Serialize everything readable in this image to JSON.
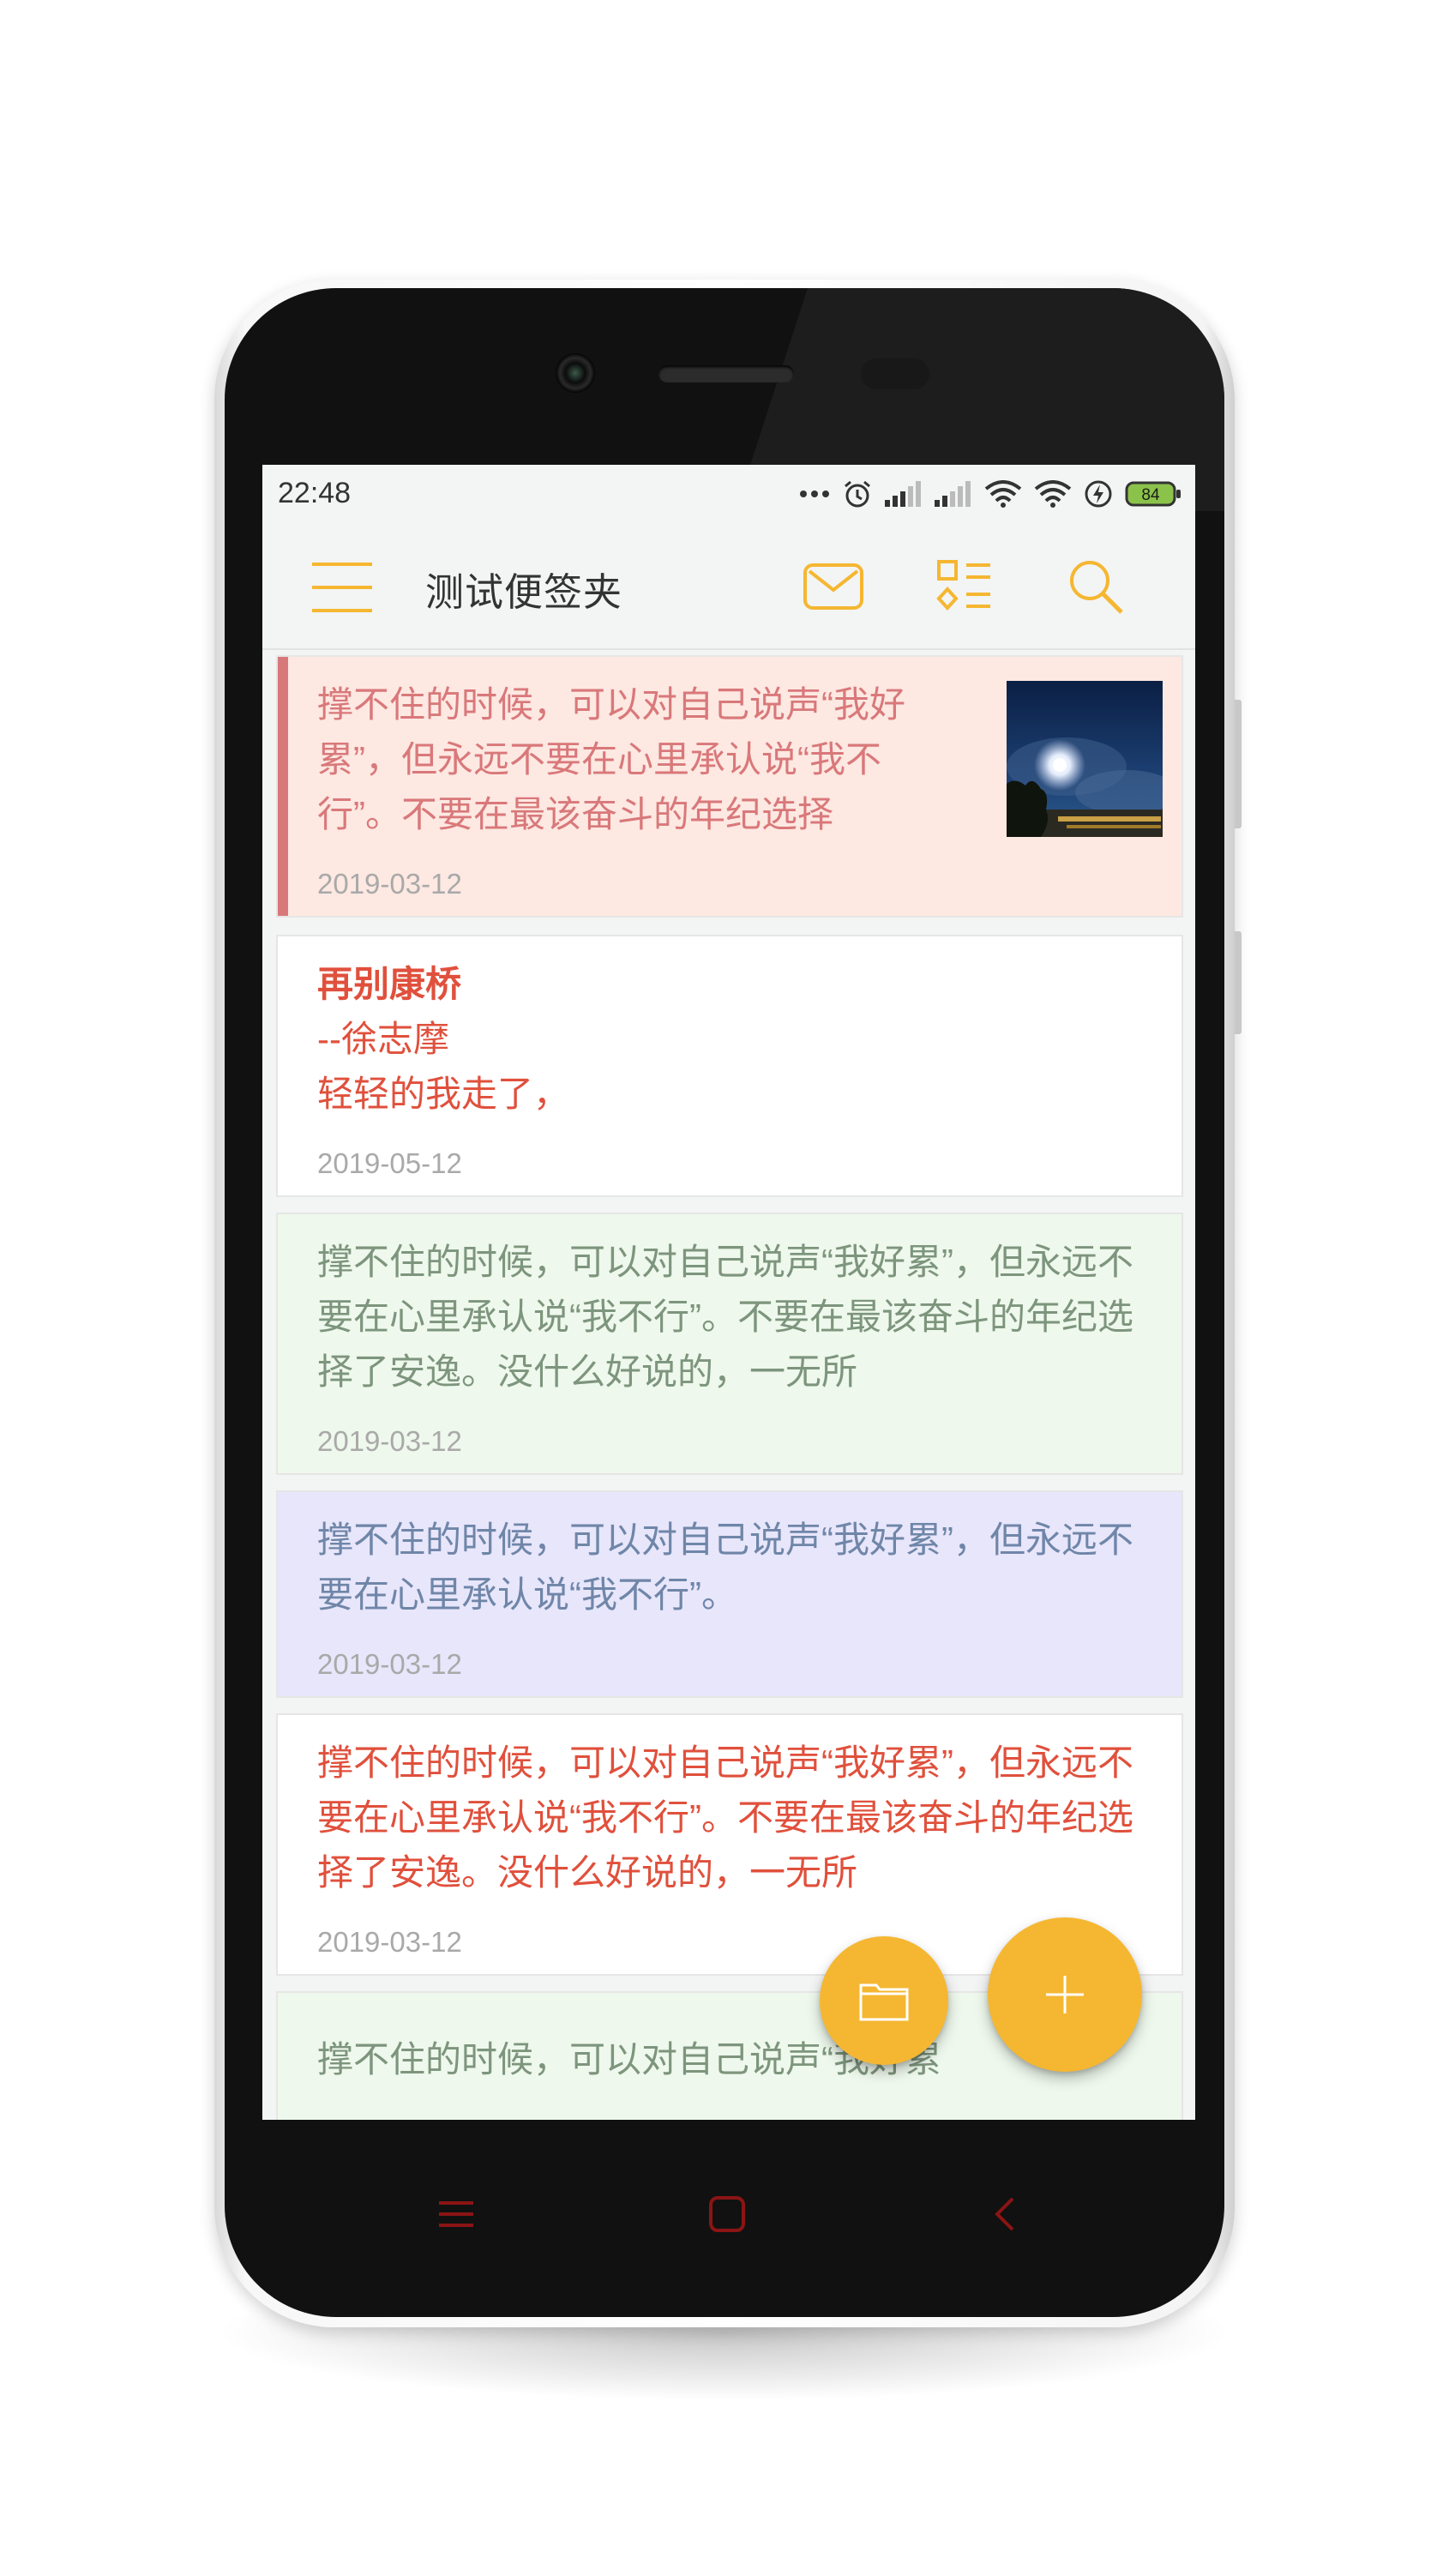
{
  "status_bar": {
    "time": "22:48",
    "battery": "84",
    "icons": [
      "more-dots-icon",
      "alarm-icon",
      "signal-1-icon",
      "signal-2-icon",
      "wifi-1-icon",
      "wifi-2-icon",
      "charging-icon",
      "battery-icon"
    ]
  },
  "app_bar": {
    "title": "测试便签夹",
    "actions": [
      "mail-icon",
      "grid-list-icon",
      "search-icon"
    ]
  },
  "notes": [
    {
      "text": "撑不住的时候，可以对自己说声“我好累”，但永远不要在心里承认说“我不行”。不要在最该奋斗的年纪选择",
      "date": "2019-03-12",
      "background": "#fde8e2",
      "text_color": "#d9787a",
      "has_image": true
    },
    {
      "title": "再别康桥",
      "text": "--徐志摩\n轻轻的我走了，",
      "date": "2019-05-12",
      "background": "#ffffff",
      "text_color": "#e0503c"
    },
    {
      "text": "撑不住的时候，可以对自己说声“我好累”，但永远不要在心里承认说“我不行”。不要在最该奋斗的年纪选择了安逸。没什么好说的，一无所",
      "date": "2019-03-12",
      "background": "#eef8ec",
      "text_color": "#7d957d"
    },
    {
      "text": "撑不住的时候，可以对自己说声“我好累”，但永远不要在心里承认说“我不行”。",
      "date": "2019-03-12",
      "background": "#e8e6fb",
      "text_color": "#6f86a8"
    },
    {
      "text": "撑不住的时候，可以对自己说声“我好累”，但永远不要在心里承认说“我不行”。不要在最该奋斗的年纪选择了安逸。没什么好说的，一无所",
      "date": "2019-03-12",
      "background": "#ffffff",
      "text_color": "#e0503c"
    },
    {
      "text": "撑不住的时候，可以对自己说声“我好累",
      "background": "#eef8ec",
      "text_color": "#7d957d"
    }
  ],
  "fabs": [
    "folder-icon",
    "add-icon"
  ],
  "nav_bar": [
    "menu-nav-icon",
    "home-nav-icon",
    "back-nav-icon"
  ],
  "colors": {
    "accent": "#f5b731",
    "nav_button": "#8b1414"
  }
}
